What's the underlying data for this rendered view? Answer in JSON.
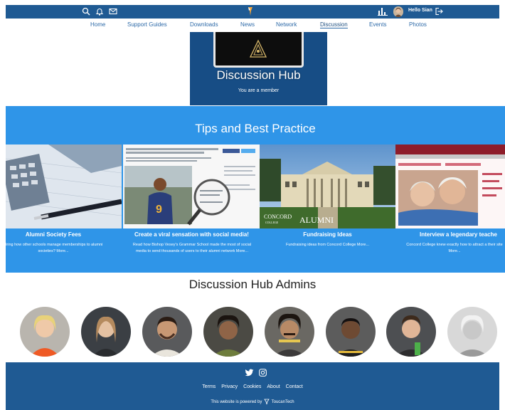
{
  "colors": {
    "header_blue": "#1f5a93",
    "tips_blue": "#2f95e8",
    "nav_link": "#2d6aa8"
  },
  "topbar": {
    "icons": [
      "search-icon",
      "bell-icon",
      "mail-icon",
      "site-logo-icon",
      "stats-icon",
      "logout-icon"
    ],
    "user_greeting": "Hello Sian"
  },
  "nav": {
    "items": [
      "Home",
      "Support Guides",
      "Downloads",
      "News",
      "Network",
      "Discussion",
      "Events",
      "Photos"
    ],
    "active": "Discussion"
  },
  "hero": {
    "title": "Discussion Hub",
    "subtitle": "You are a member"
  },
  "tips": {
    "title": "Tips and Best Practice",
    "cards": [
      {
        "title": "Alumni Society Fees",
        "desc": "Bring how other schools manage memberships to alumni societies? More..."
      },
      {
        "title": "Create a viral sensation with social media!",
        "desc": "Read how Bishop Vesey's Grammar School made the most of social media to send thousands of users to their alumni network More..."
      },
      {
        "title": "Fundraising Ideas",
        "desc": "Fundraising ideas from Concord College More..."
      },
      {
        "title": "Interview a legendary teache",
        "desc": "Concord College knew exactly how to attract a their site More..."
      }
    ],
    "image_text": {
      "college_name": "CONCORD",
      "college_sub": "COLLEGE",
      "alumni_word": "ALUMNI"
    }
  },
  "admins": {
    "title": "Discussion Hub Admins",
    "count": 8
  },
  "footer": {
    "links": [
      "Terms",
      "Privacy",
      "Cookies",
      "About",
      "Contact"
    ],
    "powered_by": "This website is powered by",
    "brand": "ToucanTech"
  }
}
